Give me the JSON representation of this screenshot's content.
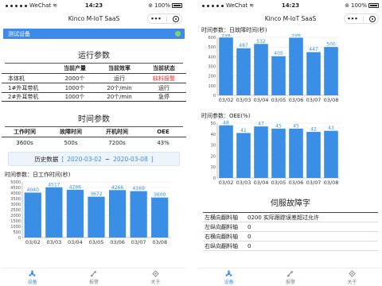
{
  "status": {
    "carrier": "WeChat",
    "time": "14:23",
    "battery": "100%"
  },
  "nav": {
    "title": "Kinco M-IoT SaaS",
    "dots": "•••"
  },
  "device": {
    "name": "测试设备"
  },
  "run": {
    "title": "运行参数",
    "headers": [
      "",
      "当前产量",
      "当前效率",
      "当前状态"
    ],
    "rows": [
      [
        "本体机",
        "2000个",
        "运行",
        "缺料报警"
      ],
      [
        "1#外耳带机",
        "1000个",
        "20个/min",
        "运行"
      ],
      [
        "2#外耳带机",
        "1000个",
        "20个/min",
        "急停"
      ]
    ]
  },
  "time": {
    "title": "时间参数",
    "headers": [
      "工作时间",
      "故障时间",
      "开机时间",
      "OEE"
    ],
    "values": [
      "3600s",
      "500s",
      "7200s",
      "43%"
    ]
  },
  "history": {
    "label": "历史数据",
    "start": "2020-03-02",
    "sep": "~",
    "end": "2020-03-08"
  },
  "tabs": [
    "设备",
    "报警",
    "关于"
  ],
  "faults": {
    "title": "伺服故障字",
    "rows": [
      {
        "name": "左横向翻料轴",
        "code": "0200",
        "desc": "实际跟踪误差超过允许"
      },
      {
        "name": "左纵向翻料轴",
        "code": "0",
        "desc": ""
      },
      {
        "name": "右横向翻料轴",
        "code": "0",
        "desc": ""
      },
      {
        "name": "右纵向翻料轴",
        "code": "0",
        "desc": ""
      }
    ]
  },
  "colors": {
    "accent": "#3c8ce7",
    "bar": "#3a8ee6",
    "alarm": "#e63232",
    "online": "#7ed36a"
  },
  "chart_data": [
    {
      "type": "bar",
      "title": "时间参数：日工作时间(秒)",
      "categories": [
        "03/02",
        "03/03",
        "03/04",
        "03/05",
        "03/06",
        "03/07",
        "03/08"
      ],
      "values": [
        4040,
        4517,
        4296,
        3672,
        4266,
        4169,
        3600
      ],
      "yticks": [
        0,
        500,
        1000,
        1500,
        2000,
        2500,
        3000,
        3500,
        4000,
        4500,
        5000
      ],
      "ylim": [
        0,
        5000
      ],
      "grid": true
    },
    {
      "type": "bar",
      "title": "时间参数：日故障时间(秒)",
      "categories": [
        "03/02",
        "03/03",
        "03/04",
        "03/05",
        "03/06",
        "03/07",
        "03/08"
      ],
      "values": [
        598,
        487,
        532,
        405,
        596,
        447,
        500
      ],
      "yticks": [
        0,
        100,
        200,
        300,
        400,
        500,
        600
      ],
      "ylim": [
        0,
        600
      ],
      "grid": true
    },
    {
      "type": "bar",
      "title": "时间参数：OEE(%)",
      "categories": [
        "03/02",
        "03/03",
        "03/04",
        "03/05",
        "03/06",
        "03/07",
        "03/08"
      ],
      "values": [
        48,
        41,
        47,
        45,
        45,
        42,
        43
      ],
      "yticks": [
        0,
        10,
        20,
        30,
        40,
        50
      ],
      "ylim": [
        0,
        50
      ],
      "grid": true
    }
  ]
}
